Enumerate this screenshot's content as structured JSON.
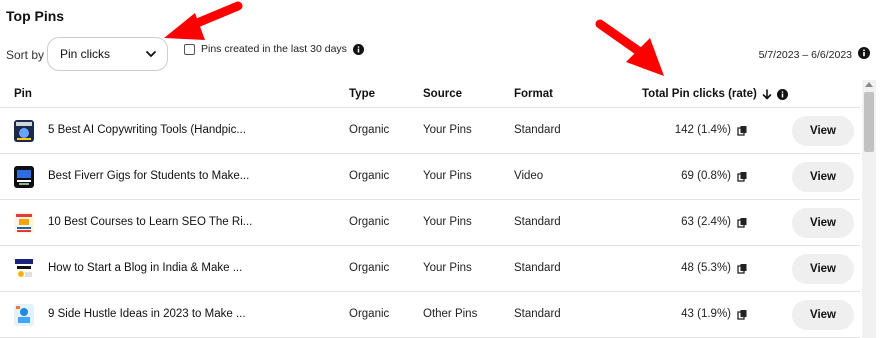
{
  "page": {
    "title": "Top Pins"
  },
  "controls": {
    "sort_label": "Sort by",
    "sort_value": "Pin clicks",
    "filter_label": "Pins created in the last 30 days",
    "filter_checked": false,
    "date_range": "5/7/2023 – 6/6/2023"
  },
  "table": {
    "headers": {
      "pin": "Pin",
      "type": "Type",
      "source": "Source",
      "format": "Format",
      "clicks": "Total Pin clicks (rate)"
    },
    "rows": [
      {
        "title": "5 Best AI Copywriting Tools (Handpic...",
        "type": "Organic",
        "source": "Your Pins",
        "format": "Standard",
        "clicks": "142 (1.4%)",
        "action": "View"
      },
      {
        "title": "Best Fiverr Gigs for Students to Make...",
        "type": "Organic",
        "source": "Your Pins",
        "format": "Video",
        "clicks": "69 (0.8%)",
        "action": "View"
      },
      {
        "title": "10 Best Courses to Learn SEO The Ri...",
        "type": "Organic",
        "source": "Your Pins",
        "format": "Standard",
        "clicks": "63 (2.4%)",
        "action": "View"
      },
      {
        "title": "How to Start a Blog in India & Make ...",
        "type": "Organic",
        "source": "Your Pins",
        "format": "Standard",
        "clicks": "48 (5.3%)",
        "action": "View"
      },
      {
        "title": "9 Side Hustle Ideas in 2023 to Make ...",
        "type": "Organic",
        "source": "Other Pins",
        "format": "Standard",
        "clicks": "43 (1.9%)",
        "action": "View"
      }
    ]
  },
  "colors": {
    "annotation_arrow": "#ff0000",
    "button_bg": "#efefef"
  }
}
